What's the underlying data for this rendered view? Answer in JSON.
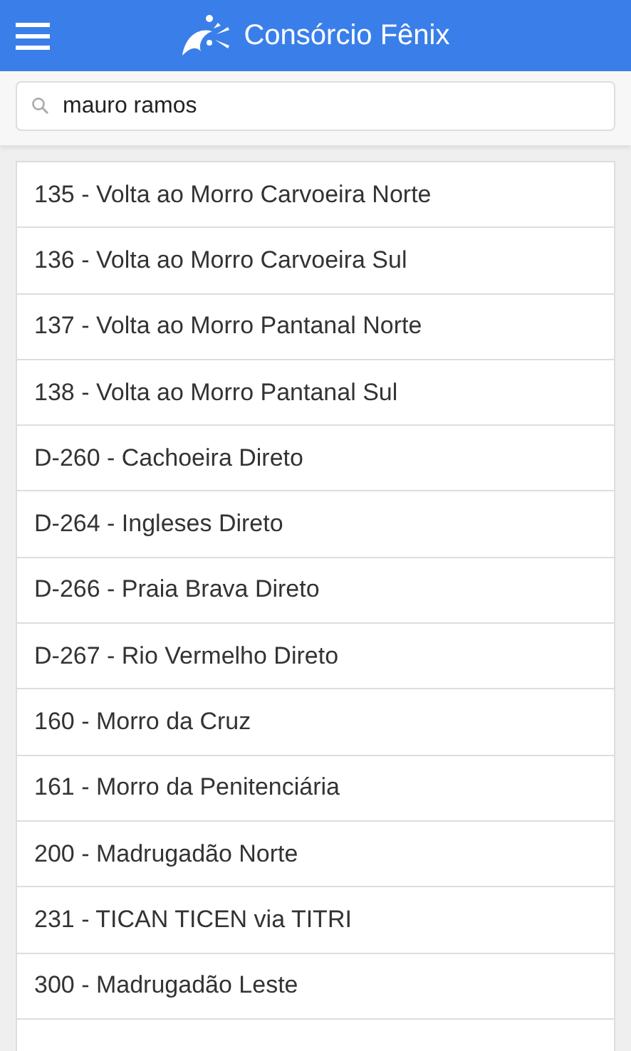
{
  "header": {
    "title": "Consórcio Fênix"
  },
  "search": {
    "value": "mauro ramos"
  },
  "routes": [
    {
      "label": "135 - Volta ao Morro Carvoeira Norte"
    },
    {
      "label": "136 - Volta ao Morro Carvoeira Sul"
    },
    {
      "label": "137 - Volta ao Morro Pantanal Norte"
    },
    {
      "label": "138 - Volta ao Morro Pantanal Sul"
    },
    {
      "label": "D-260 - Cachoeira Direto"
    },
    {
      "label": "D-264 - Ingleses Direto"
    },
    {
      "label": "D-266 - Praia Brava Direto"
    },
    {
      "label": "D-267 - Rio Vermelho Direto"
    },
    {
      "label": "160 - Morro da Cruz"
    },
    {
      "label": "161 - Morro da Penitenciária"
    },
    {
      "label": "200 - Madrugadão Norte"
    },
    {
      "label": "231 - TICAN TICEN via TITRI"
    },
    {
      "label": "300 - Madrugadão Leste"
    }
  ]
}
